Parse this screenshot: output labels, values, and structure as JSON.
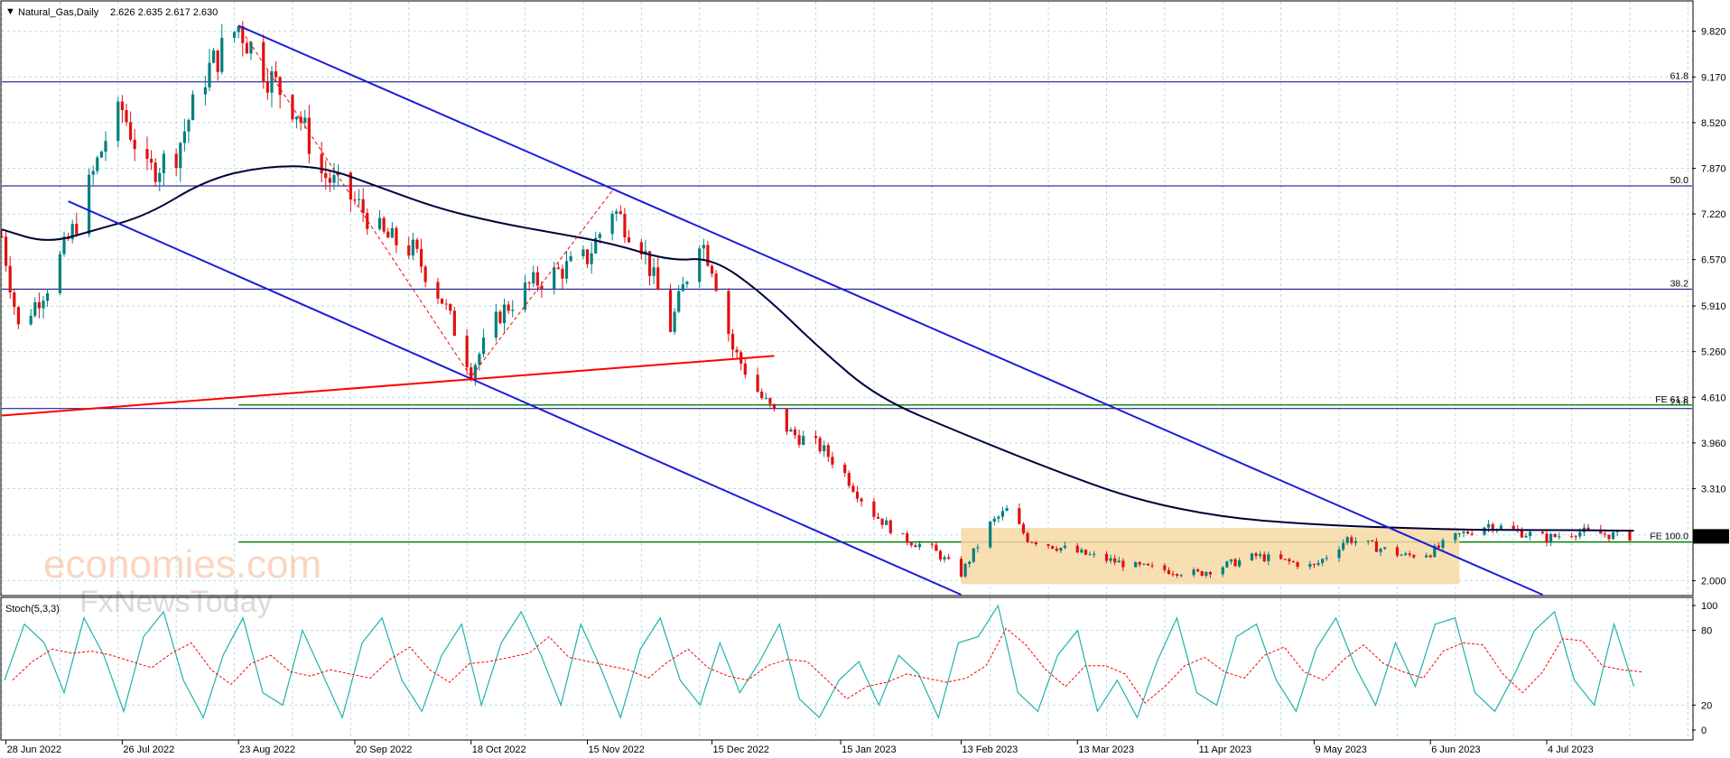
{
  "header": {
    "symbol_text": "Natural_Gas,Daily",
    "ohlc_text": "2.626 2.635 2.617 2.630"
  },
  "price_axis": {
    "ticks": [
      "9.820",
      "9.170",
      "8.520",
      "7.870",
      "7.220",
      "6.570",
      "5.910",
      "5.260",
      "4.610",
      "3.960",
      "3.310",
      "2.000"
    ],
    "last_price": "2.630"
  },
  "time_axis": {
    "labels": [
      "28 Jun 2022",
      "26 Jul 2022",
      "23 Aug 2022",
      "20 Sep 2022",
      "18 Oct 2022",
      "15 Nov 2022",
      "15 Dec 2022",
      "15 Jan 2023",
      "13 Feb 2023",
      "13 Mar 2023",
      "11 Apr 2023",
      "9 May 2023",
      "6 Jun 2023",
      "4 Jul 2023"
    ]
  },
  "levels": {
    "fib_618": "61.8",
    "fib_50": "50.0",
    "fib_382": "38.2",
    "fe_618": "FE 61.8",
    "fib_236": "23.6",
    "fe_100": "FE 100.0"
  },
  "stoch": {
    "header_text": "Stoch(5,3,3)",
    "ticks": [
      "100",
      "80",
      "20",
      "0"
    ]
  },
  "watermark": {
    "brand": "economies.com",
    "sub": "FxNewsToday"
  },
  "colors": {
    "up_candle": "#008080",
    "down_candle": "#e01010",
    "channel": "#1d1dd8",
    "trendline": "#ff0000",
    "fib_line": "#000080",
    "fe_line": "#008000",
    "ma_line": "#00003a",
    "consolidation_box": "#f7d9a4",
    "stoch_main": "#20b2aa",
    "stoch_signal": "#ff0000",
    "grid": "#b9dede"
  },
  "chart_data": {
    "type": "candlestick",
    "instrument": "Natural_Gas",
    "timeframe": "Daily",
    "last_ohlc": {
      "open": 2.626,
      "high": 2.635,
      "low": 2.617,
      "close": 2.63
    },
    "ylim": [
      1.8,
      10.2
    ],
    "x_range": [
      "2022-06-27",
      "2023-08-08"
    ],
    "series": [
      {
        "name": "Natural_Gas",
        "price_path": [
          [
            "2022-06-27",
            6.9
          ],
          [
            "2022-07-01",
            5.6
          ],
          [
            "2022-07-08",
            6.2
          ],
          [
            "2022-07-15",
            7.1
          ],
          [
            "2022-07-22",
            8.3
          ],
          [
            "2022-07-26",
            8.7
          ],
          [
            "2022-08-01",
            7.8
          ],
          [
            "2022-08-08",
            8.1
          ],
          [
            "2022-08-15",
            9.2
          ],
          [
            "2022-08-23",
            9.9
          ],
          [
            "2022-08-30",
            9.2
          ],
          [
            "2022-09-06",
            8.7
          ],
          [
            "2022-09-12",
            7.8
          ],
          [
            "2022-09-20",
            7.4
          ],
          [
            "2022-09-27",
            6.9
          ],
          [
            "2022-10-04",
            6.7
          ],
          [
            "2022-10-11",
            6.0
          ],
          [
            "2022-10-18",
            5.0
          ],
          [
            "2022-10-25",
            5.8
          ],
          [
            "2022-11-01",
            6.2
          ],
          [
            "2022-11-08",
            6.4
          ],
          [
            "2022-11-15",
            6.6
          ],
          [
            "2022-11-21",
            7.3
          ],
          [
            "2022-11-28",
            6.8
          ],
          [
            "2022-12-05",
            5.6
          ],
          [
            "2022-12-12",
            6.9
          ],
          [
            "2022-12-15",
            6.5
          ],
          [
            "2022-12-20",
            5.3
          ],
          [
            "2022-12-27",
            4.6
          ],
          [
            "2023-01-03",
            4.1
          ],
          [
            "2023-01-10",
            3.9
          ],
          [
            "2023-01-15",
            3.6
          ],
          [
            "2023-01-22",
            3.0
          ],
          [
            "2023-01-30",
            2.6
          ],
          [
            "2023-02-06",
            2.45
          ],
          [
            "2023-02-13",
            2.1
          ],
          [
            "2023-02-20",
            2.8
          ],
          [
            "2023-02-24",
            3.0
          ],
          [
            "2023-03-01",
            2.6
          ],
          [
            "2023-03-13",
            2.4
          ],
          [
            "2023-03-27",
            2.2
          ],
          [
            "2023-04-11",
            2.1
          ],
          [
            "2023-04-25",
            2.35
          ],
          [
            "2023-05-09",
            2.2
          ],
          [
            "2023-05-17",
            2.6
          ],
          [
            "2023-05-31",
            2.35
          ],
          [
            "2023-06-06",
            2.4
          ],
          [
            "2023-06-13",
            2.65
          ],
          [
            "2023-06-20",
            2.8
          ],
          [
            "2023-06-27",
            2.7
          ],
          [
            "2023-07-04",
            2.6
          ],
          [
            "2023-07-11",
            2.7
          ],
          [
            "2023-07-20",
            2.65
          ],
          [
            "2023-07-25",
            2.63
          ]
        ]
      },
      {
        "name": "Moving Average",
        "values": [
          [
            "2022-06-27",
            7.0
          ],
          [
            "2022-07-08",
            6.8
          ],
          [
            "2022-07-20",
            7.0
          ],
          [
            "2022-08-01",
            7.2
          ],
          [
            "2022-08-15",
            7.7
          ],
          [
            "2022-08-29",
            7.9
          ],
          [
            "2022-09-12",
            7.9
          ],
          [
            "2022-09-26",
            7.6
          ],
          [
            "2022-10-10",
            7.3
          ],
          [
            "2022-10-24",
            7.1
          ],
          [
            "2022-11-07",
            6.95
          ],
          [
            "2022-11-21",
            6.8
          ],
          [
            "2022-12-05",
            6.55
          ],
          [
            "2022-12-15",
            6.6
          ],
          [
            "2022-12-27",
            6.1
          ],
          [
            "2023-01-10",
            5.3
          ],
          [
            "2023-01-24",
            4.6
          ],
          [
            "2023-02-13",
            4.1
          ],
          [
            "2023-03-06",
            3.6
          ],
          [
            "2023-03-27",
            3.15
          ],
          [
            "2023-04-17",
            2.9
          ],
          [
            "2023-05-08",
            2.8
          ],
          [
            "2023-05-29",
            2.75
          ],
          [
            "2023-06-19",
            2.72
          ],
          [
            "2023-07-10",
            2.72
          ],
          [
            "2023-07-25",
            2.71
          ]
        ]
      },
      {
        "name": "Stoch(5,3,3)",
        "scale": [
          0,
          100
        ],
        "main": [
          40,
          85,
          70,
          30,
          90,
          60,
          15,
          75,
          95,
          40,
          10,
          60,
          90,
          30,
          20,
          80,
          45,
          10,
          70,
          90,
          40,
          15,
          60,
          85,
          20,
          70,
          95,
          60,
          20,
          85,
          50,
          10,
          65,
          90,
          40,
          20,
          70,
          30,
          55,
          85,
          25,
          10,
          40,
          55,
          20,
          60,
          45,
          10,
          70,
          75,
          100,
          30,
          15,
          60,
          80,
          15,
          40,
          10,
          55,
          90,
          30,
          20,
          75,
          85,
          40,
          15,
          65,
          90,
          50,
          20,
          70,
          35,
          85,
          90,
          30,
          15,
          45,
          80,
          95,
          40,
          20,
          85,
          35
        ]
      }
    ],
    "channel": {
      "upper": [
        [
          "2022-08-23",
          9.9
        ],
        [
          "2023-07-03",
          1.8
        ]
      ],
      "lower": [
        [
          "2022-07-13",
          7.4
        ],
        [
          "2023-02-13",
          1.8
        ]
      ]
    },
    "trendline": [
      [
        "2022-06-27",
        4.35
      ],
      [
        "2022-12-30",
        5.2
      ]
    ],
    "fib_levels": [
      {
        "label": "61.8",
        "price": 9.1
      },
      {
        "label": "50.0",
        "price": 7.62
      },
      {
        "label": "38.2",
        "price": 6.15
      },
      {
        "label": "23.6",
        "price": 4.45
      },
      {
        "label": "FE 61.8",
        "price": 4.5
      },
      {
        "label": "FE 100.0",
        "price": 2.55
      }
    ],
    "consolidation_zone": {
      "from": "2023-02-13",
      "to": "2023-06-13",
      "low": 1.95,
      "high": 2.75
    }
  }
}
